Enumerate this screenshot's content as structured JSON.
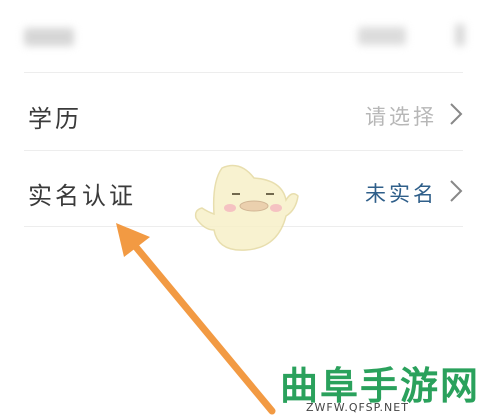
{
  "rows": [
    {
      "label": "学历",
      "value": "请选择",
      "value_color": "#b7b7b7"
    },
    {
      "label": "实名认证",
      "value": "未实名",
      "value_color": "#2f5f8a"
    }
  ],
  "icons": {
    "chevron": "chevron-right-icon",
    "mascot": "chick-mascot",
    "arrow": "pointer-arrow"
  },
  "colors": {
    "arrow": "#f29a43",
    "watermark": "#2aa15c",
    "divider": "#ededed"
  },
  "watermark": {
    "title": "曲阜手游网",
    "url": "ZWFW.QFSP.NET"
  }
}
